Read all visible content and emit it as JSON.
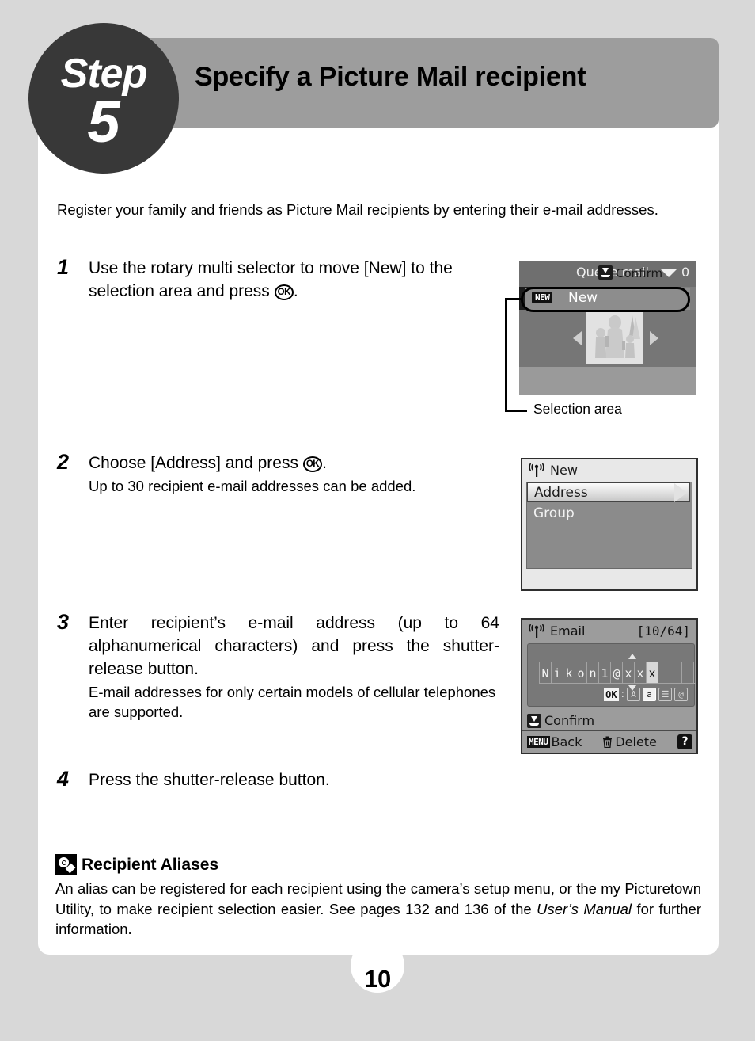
{
  "header": {
    "step_word": "Step",
    "step_number": "5",
    "title": "Specify a Picture Mail recipient"
  },
  "intro": "Register your family and friends as Picture Mail recipients by entering their e-mail addresses.",
  "steps": [
    {
      "number": "1",
      "lead_pre": "Use the rotary multi selector to move [New] to the selection area and press ",
      "ok_glyph": "OK",
      "lead_post": ".",
      "sub": ""
    },
    {
      "number": "2",
      "lead_pre": "Choose [Address] and press ",
      "ok_glyph": "OK",
      "lead_post": ".",
      "sub": "Up to 30 recipient e-mail addresses can be added."
    },
    {
      "number": "3",
      "lead_pre": "Enter recipient’s e-mail address (up to 64 alphanumerical characters) and press the shutter-release button.",
      "ok_glyph": "",
      "lead_post": "",
      "sub": "E-mail addresses for only certain models of cellular telephones are supported."
    },
    {
      "number": "4",
      "lead_pre": "Press the shutter-release button.",
      "ok_glyph": "",
      "lead_post": "",
      "sub": ""
    }
  ],
  "callout": {
    "label": "Selection area"
  },
  "screen1": {
    "title": "Queue mail",
    "mail_count": "0",
    "new_badge": "NEW",
    "new_label": "New",
    "confirm_label": "Confirm"
  },
  "screen2": {
    "title": "New",
    "items": [
      {
        "label": "Address",
        "selected": true
      },
      {
        "label": "Group",
        "selected": false
      }
    ]
  },
  "screen3": {
    "title": "Email",
    "counter": "[10/64]",
    "entered_text": "Nikon1@xxx",
    "total_cells": 17,
    "cursor_index": 9,
    "ok_label": "OK",
    "mode_colon": ":",
    "modes": [
      {
        "label": "A",
        "active": false
      },
      {
        "label": "a",
        "active": true
      },
      {
        "label": "☰",
        "active": false
      },
      {
        "label": "@",
        "active": false
      }
    ],
    "confirm_label": "Confirm",
    "menu_label": "MENU",
    "back_label": "Back",
    "delete_label": "Delete",
    "help_label": "?"
  },
  "note": {
    "title": "Recipient Aliases",
    "text_part1": "An alias can be registered for each recipient using the camera’s setup menu, or the my Picturetown Utility, to make recipient selection easier. See pages 132 and 136 of the ",
    "italic": "User’s Manual",
    "text_part2": " for further information."
  },
  "page_number": "10"
}
